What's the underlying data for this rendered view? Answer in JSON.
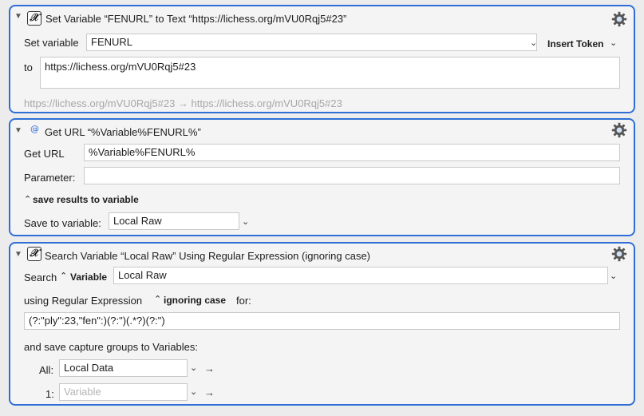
{
  "action1": {
    "title": "Set Variable “FENURL” to Text “https://lichess.org/mVU0Rqj5#23”",
    "set_variable_label": "Set variable",
    "variable_value": "FENURL",
    "insert_token_label": "Insert Token",
    "to_label": "to",
    "text_value": "https://lichess.org/mVU0Rqj5#23",
    "preview_text": "https://lichess.org/mVU0Rqj5#23 → https://lichess.org/mVU0Rqj5#23"
  },
  "action2": {
    "title": "Get URL “%Variable%FENURL%”",
    "get_url_label": "Get URL",
    "url_value": "%Variable%FENURL%",
    "parameter_label": "Parameter:",
    "parameter_value": "",
    "save_results_label": "save results to variable",
    "save_to_label": "Save to variable:",
    "save_to_value": "Local Raw"
  },
  "action3": {
    "title": "Search Variable “Local Raw” Using Regular Expression (ignoring case)",
    "search_label": "Search",
    "variable_popup_label": "Variable",
    "search_value": "Local Raw",
    "using_label": "using Regular Expression",
    "case_popup_label": "ignoring case",
    "for_label": "for:",
    "regex_value": "(?:\"ply\":23,\"fen\":)(?:\")(.*?)(?:\")",
    "save_capture_label": "and save capture groups to Variables:",
    "all_label": "All:",
    "all_value": "Local Data",
    "one_label": "1:",
    "one_placeholder": "Variable"
  },
  "icons": {
    "disclosure": "disclosure-triangle-icon",
    "variable": "variable-x-icon",
    "url": "at-sign-icon",
    "gear": "gear-icon",
    "chevron": "chevron-down-icon",
    "stepper": "up-down-stepper-icon",
    "arrow": "right-arrow-icon"
  },
  "colors": {
    "accent": "#2f6ed6",
    "panel_bg": "#f4f4f4",
    "window_bg": "#ececec",
    "placeholder": "#b5b5b5"
  }
}
